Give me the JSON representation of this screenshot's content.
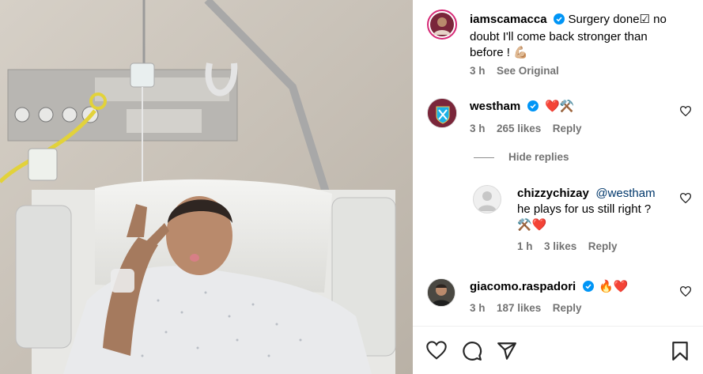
{
  "post": {
    "author": "iamscamacca",
    "caption_line1": "Surgery done☑ no",
    "caption_line2": "doubt I'll come back stronger than",
    "caption_line3": "before ! 💪🏼",
    "time": "3 h",
    "see_original": "See Original"
  },
  "comments": [
    {
      "user": "westham",
      "verified": true,
      "text": "❤️⚒️",
      "time": "3 h",
      "likes": "265 likes",
      "reply": "Reply"
    },
    {
      "user": "giacomo.raspadori",
      "verified": true,
      "text": "🔥❤️",
      "time": "3 h",
      "likes": "187 likes",
      "reply": "Reply"
    }
  ],
  "hide_replies": "Hide replies",
  "reply": {
    "user": "chizzychizay",
    "mention": "@westham",
    "text_line1": "he plays for us still right ?",
    "text_line2": "⚒️❤️",
    "time": "1 h",
    "likes": "3 likes",
    "reply": "Reply"
  },
  "colors": {
    "verified": "#0095f6",
    "meta": "#737373",
    "westham_claret": "#7a263a",
    "westham_blue": "#1bb1e7"
  },
  "icons": [
    "heart-icon",
    "comment-icon",
    "share-icon",
    "bookmark-icon",
    "verified-badge-icon"
  ]
}
